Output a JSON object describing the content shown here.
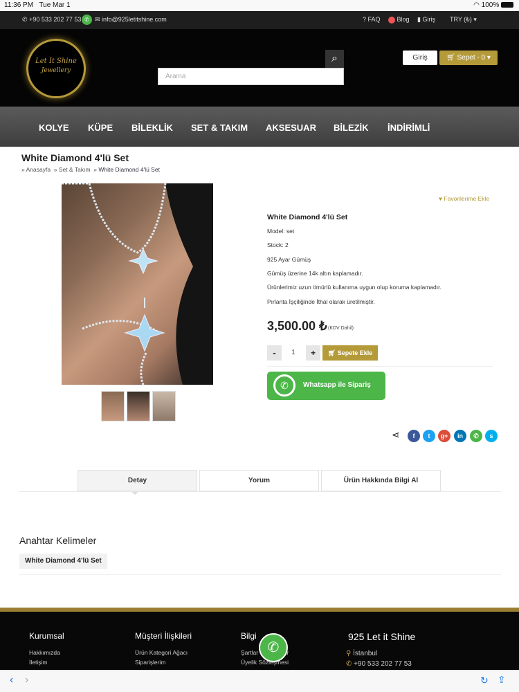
{
  "status": {
    "time": "11:36 PM",
    "date": "Tue Mar 1",
    "battery": "100%"
  },
  "topbar": {
    "phone": "+90 533 202 77 53",
    "email": "info@925letitshine.com",
    "faq": "FAQ",
    "blog": "Blog",
    "login": "Giriş",
    "currency": "TRY (₺)"
  },
  "logo": {
    "line1": "Let It Shine",
    "line2": "Jewellery"
  },
  "header": {
    "search_placeholder": "Arama",
    "login": "Giriş",
    "cart": "Sepet - 0"
  },
  "nav": [
    "KOLYE",
    "KÜPE",
    "BİLEKLİK",
    "SET & TAKIM",
    "AKSESUAR",
    "BİLEZİK",
    "İNDİRİMLİ"
  ],
  "page": {
    "title": "White Diamond 4'lü Set",
    "breadcrumb": [
      "Anasayfa",
      "Set & Takım",
      "White Diamond 4'lü Set"
    ]
  },
  "product": {
    "favorite": "Favorilerime Ekle",
    "name": "White Diamond 4'lü Set",
    "model": "Model: set",
    "stock": "Stock: 2",
    "d1": "925 Ayar Gümüş",
    "d2": "Gümüş üzerine 14k altın kaplamadır.",
    "d3": "Ürünlerimiz uzun ömürlü kullanıma uygun olup koruma kaplamadır.",
    "d4": "Pırlanta İşçiliğinde İthal olarak üretilmiştir.",
    "price": "3,500.00 ₺",
    "tax": "(KDV Dahil)",
    "qty": "1",
    "minus": "-",
    "plus": "+",
    "add_to_cart": "Sepete Ekle",
    "whatsapp": "Whatsapp ile Sipariş"
  },
  "tabs": [
    "Detay",
    "Yorum",
    "Ürün Hakkında Bilgi Al"
  ],
  "keywords": {
    "title": "Anahtar Kelimeler",
    "tag": "White Diamond 4'lü Set"
  },
  "footer": {
    "c1": {
      "title": "Kurumsal",
      "items": [
        "Hakkımızda",
        "İletişim"
      ]
    },
    "c2": {
      "title": "Müşteri İlişkileri",
      "items": [
        "Ürün Kategori Ağacı",
        "Siparişlerim"
      ]
    },
    "c3": {
      "title": "Bilgi",
      "items": [
        "Şartlar ve Koşullar",
        "Üyelik Sözleşmesi"
      ]
    },
    "c4": {
      "title": "925 Let it Shine",
      "city": "İstanbul",
      "phone": "+90 533 202 77 53"
    }
  },
  "colors": {
    "gold": "#b59a3a",
    "whatsapp": "#4cb648",
    "facebook": "#3b5998",
    "twitter": "#1da1f2",
    "google": "#dd4b39",
    "linkedin": "#0077b5",
    "skype": "#00aff0"
  }
}
